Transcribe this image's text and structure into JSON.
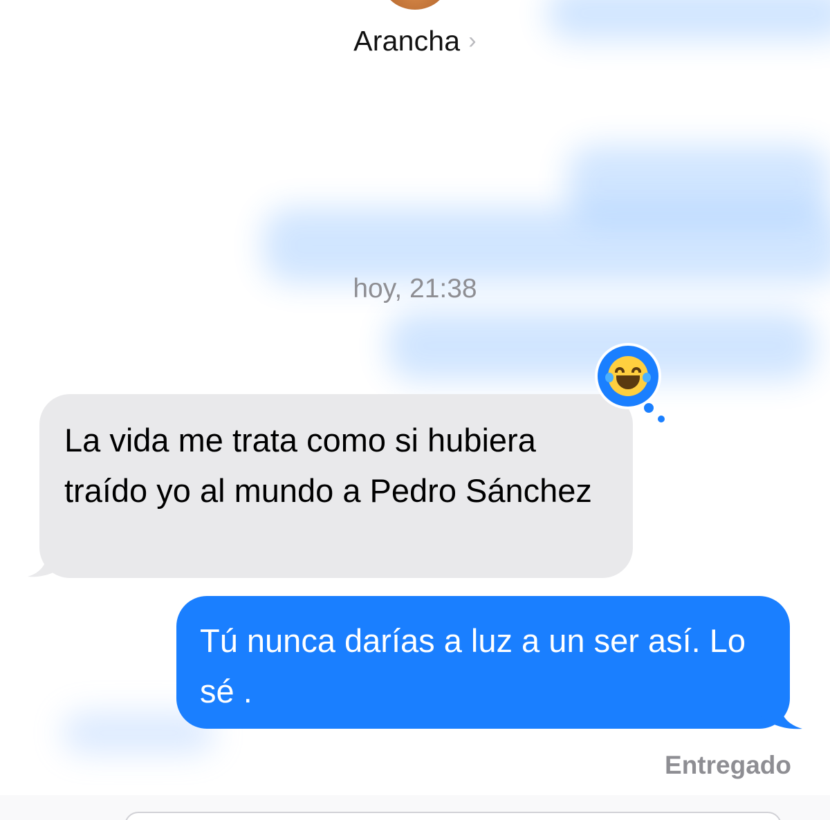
{
  "header": {
    "contact_name": "Arancha",
    "chevron": "›"
  },
  "timestamp": "hoy, 21:38",
  "messages": [
    {
      "direction": "incoming",
      "text": "La vida me trata como si hubiera traído yo al mundo a Pedro Sánchez",
      "reaction": "face-with-tears-of-joy-icon"
    },
    {
      "direction": "outgoing",
      "text": "Tú nunca darías a luz a un ser así. Lo sé ."
    }
  ],
  "delivery_status": "Entregado",
  "colors": {
    "outgoing_bubble": "#1a7fff",
    "incoming_bubble": "#e9e9eb",
    "secondary_text": "#8e8e93"
  }
}
